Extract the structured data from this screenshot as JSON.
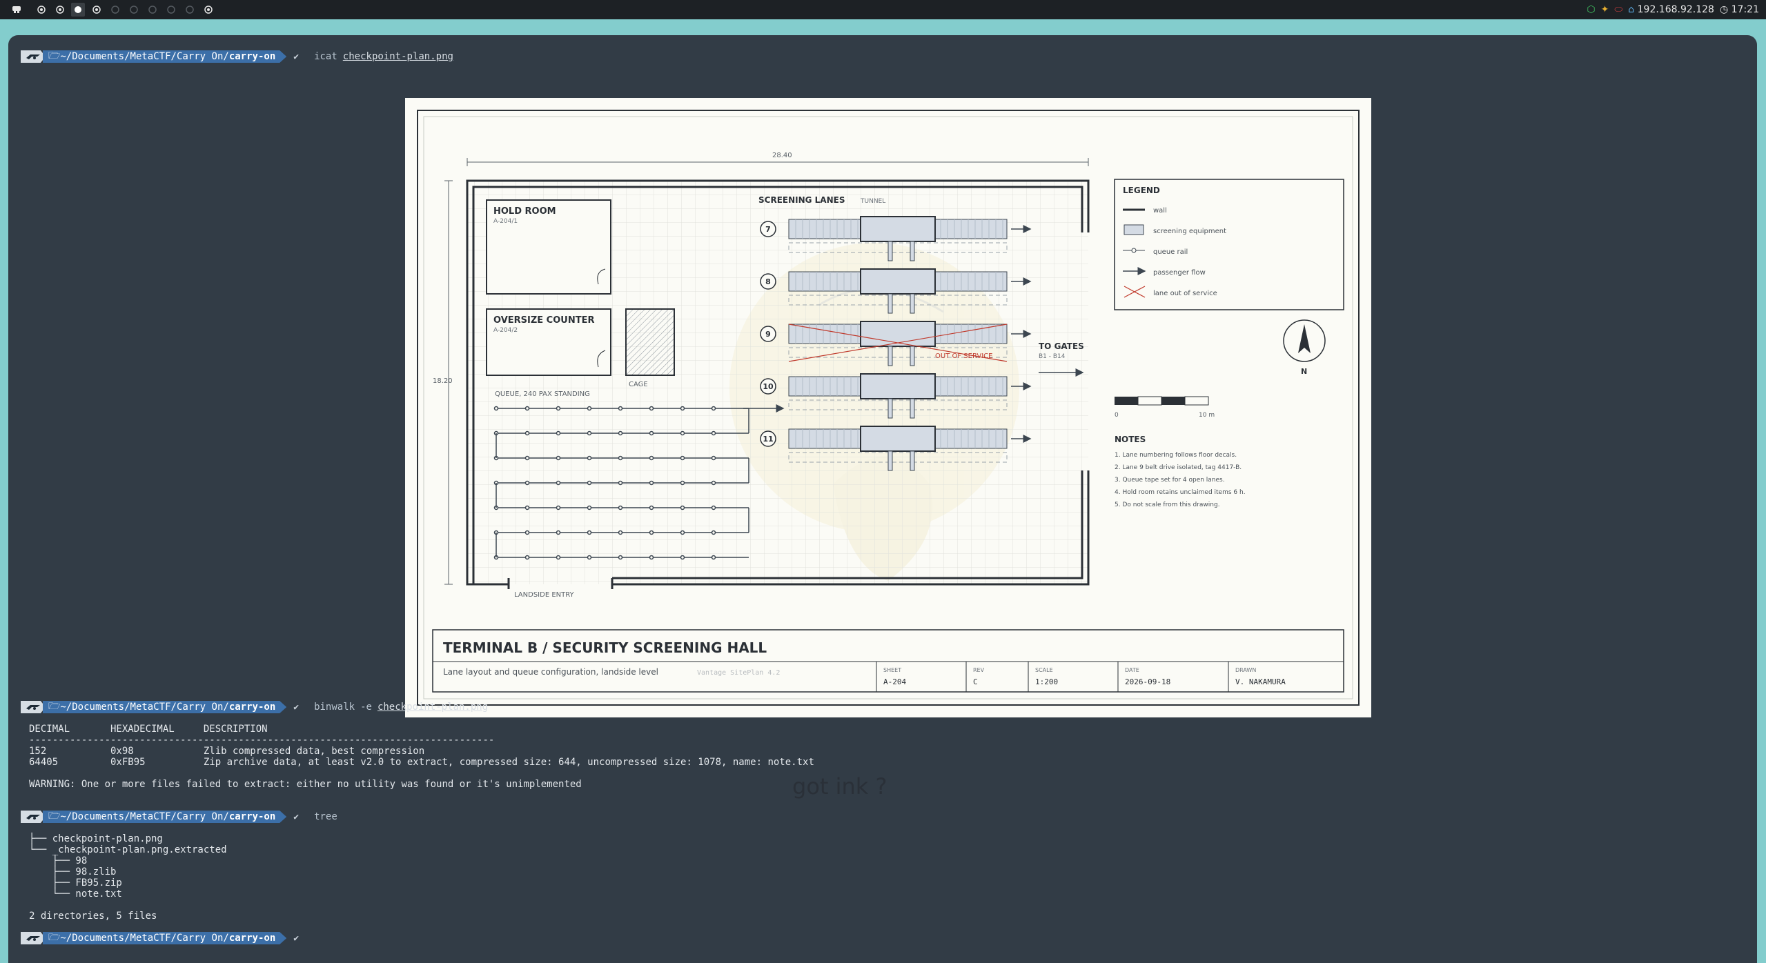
{
  "topbar": {
    "ip": "192.168.92.128",
    "time": "17:21",
    "workspaces": [
      "ws-1",
      "ws-2",
      "ws-3",
      "ws-4",
      "ws-5",
      "ws-6",
      "ws-7",
      "ws-8",
      "ws-9",
      "ws-10"
    ]
  },
  "prompt": {
    "path_prefix": "~/Documents/MetaCTF/Carry On/",
    "path_dir": "carry-on",
    "check": "✔"
  },
  "commands": [
    {
      "cmd": "icat",
      "arg": "checkpoint-plan.png"
    },
    {
      "cmd": "binwalk",
      "flag": "-e",
      "arg": "checkpoint-plan.png"
    },
    {
      "cmd": "tree"
    }
  ],
  "binwalk": {
    "header": "DECIMAL       HEXADECIMAL     DESCRIPTION",
    "rule": "--------------------------------------------------------------------------------",
    "rows": [
      "152           0x98            Zlib compressed data, best compression",
      "64405         0xFB95          Zip archive data, at least v2.0 to extract, compressed size: 644, uncompressed size: 1078, name: note.txt"
    ],
    "warning": "WARNING: One or more files failed to extract: either no utility was found or it's unimplemented"
  },
  "tree": {
    "lines": [
      "├── checkpoint-plan.png",
      "└── _checkpoint-plan.png.extracted",
      "    ├── 98",
      "    ├── 98.zlib",
      "    ├── FB95.zip",
      "    └── note.txt"
    ],
    "summary": "2 directories, 5 files"
  },
  "ghost_text": "got ink ?",
  "plan": {
    "dim_width": "28.40",
    "dim_height": "18.20",
    "hold_room": {
      "title": "HOLD ROOM",
      "code": "A-204/1"
    },
    "oversize": {
      "title": "OVERSIZE COUNTER",
      "code": "A-204/2"
    },
    "cage": "CAGE",
    "queue_label": "QUEUE, 240 PAX STANDING",
    "landside": "LANDSIDE ENTRY",
    "lanes_title": "SCREENING LANES",
    "tunnel": "TUNNEL",
    "lanes": [
      "7",
      "8",
      "9",
      "10",
      "11"
    ],
    "out_of_service": "OUT OF SERVICE",
    "to_gates": "TO GATES",
    "gates_range": "B1 - B14",
    "legend": {
      "title": "LEGEND",
      "items": [
        "wall",
        "screening equipment",
        "queue rail",
        "passenger flow",
        "lane out of service"
      ]
    },
    "north": "N",
    "scale_start": "0",
    "scale_end": "10 m",
    "notes": {
      "title": "NOTES",
      "items": [
        "1. Lane numbering follows floor decals.",
        "2. Lane 9 belt drive isolated, tag 4417-B.",
        "3. Queue tape set for 4 open lanes.",
        "4. Hold room retains unclaimed items 6 h.",
        "5. Do not scale from this drawing."
      ]
    },
    "title_block": {
      "title": "TERMINAL B / SECURITY SCREENING HALL",
      "subtitle": "Lane layout and queue configuration, landside level",
      "software": "Vantage SitePlan 4.2",
      "sheet_label": "SHEET",
      "sheet": "A-204",
      "rev_label": "REV",
      "rev": "C",
      "scale_label": "SCALE",
      "scale": "1:200",
      "date_label": "DATE",
      "date": "2026-09-18",
      "drawn_label": "DRAWN",
      "drawn": "V. NAKAMURA"
    }
  }
}
